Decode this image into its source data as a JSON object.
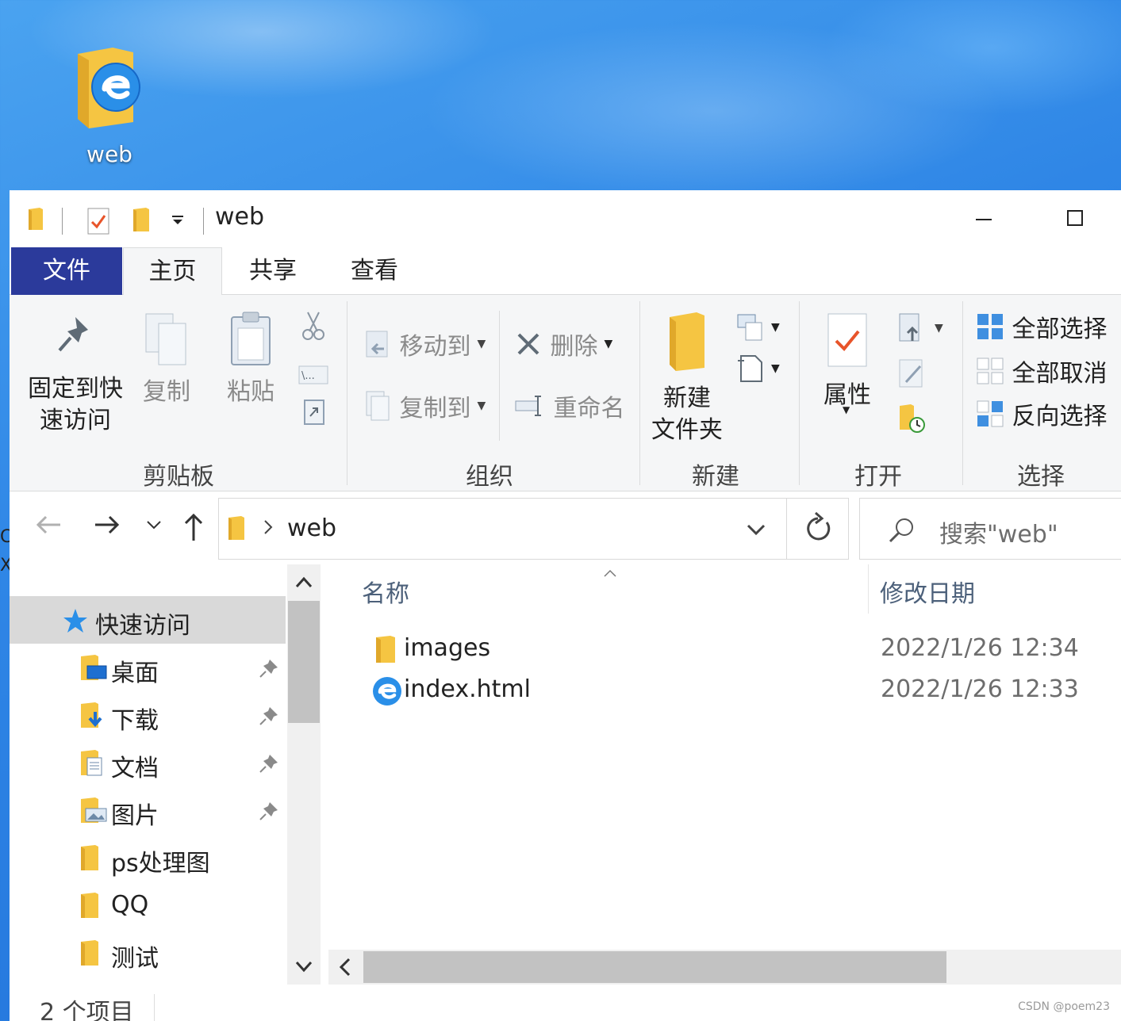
{
  "desktop": {
    "icon_label": "web",
    "left_edge_text_1": "C",
    "left_edge_text_2": "X"
  },
  "window": {
    "title": "web"
  },
  "tabs": {
    "file": "文件",
    "home": "主页",
    "share": "共享",
    "view": "查看"
  },
  "ribbon": {
    "clipboard": {
      "pin_line1": "固定到快",
      "pin_line2": "速访问",
      "copy": "复制",
      "paste": "粘贴",
      "copy_path_glyph": "\\...",
      "group": "剪贴板"
    },
    "organize": {
      "move_to": "移动到",
      "copy_to": "复制到",
      "delete": "删除",
      "rename": "重命名",
      "group": "组织"
    },
    "new": {
      "new_folder_line1": "新建",
      "new_folder_line2": "文件夹",
      "group": "新建"
    },
    "open": {
      "properties": "属性",
      "group": "打开"
    },
    "select": {
      "select_all": "全部选择",
      "select_none": "全部取消",
      "invert": "反向选择",
      "group": "选择"
    }
  },
  "address": {
    "crumb": "web",
    "search_placeholder": "搜索\"web\""
  },
  "nav": {
    "quick_access": "快速访问",
    "items": [
      {
        "label": "桌面",
        "pinned": true,
        "icon": "desktop-folder-icon"
      },
      {
        "label": "下载",
        "pinned": true,
        "icon": "downloads-folder-icon"
      },
      {
        "label": "文档",
        "pinned": true,
        "icon": "documents-folder-icon"
      },
      {
        "label": "图片",
        "pinned": true,
        "icon": "pictures-folder-icon"
      },
      {
        "label": "ps处理图",
        "pinned": false,
        "icon": "folder-icon"
      },
      {
        "label": "QQ",
        "pinned": false,
        "icon": "folder-icon"
      },
      {
        "label": "测试",
        "pinned": false,
        "icon": "folder-icon"
      }
    ]
  },
  "files": {
    "columns": {
      "name": "名称",
      "modified": "修改日期"
    },
    "rows": [
      {
        "name": "images",
        "modified": "2022/1/26 12:34",
        "icon": "folder-icon"
      },
      {
        "name": "index.html",
        "modified": "2022/1/26 12:33",
        "icon": "edge-html-icon"
      }
    ]
  },
  "status": {
    "item_count": "2 个项目"
  },
  "watermark": "CSDN @poem23",
  "colors": {
    "file_tab": "#2b3a9b",
    "selected_nav": "#d9d9d9",
    "ribbon_bg": "#f5f6f7",
    "folder": "#f7d162",
    "accent_blue": "#2a8fe8"
  }
}
